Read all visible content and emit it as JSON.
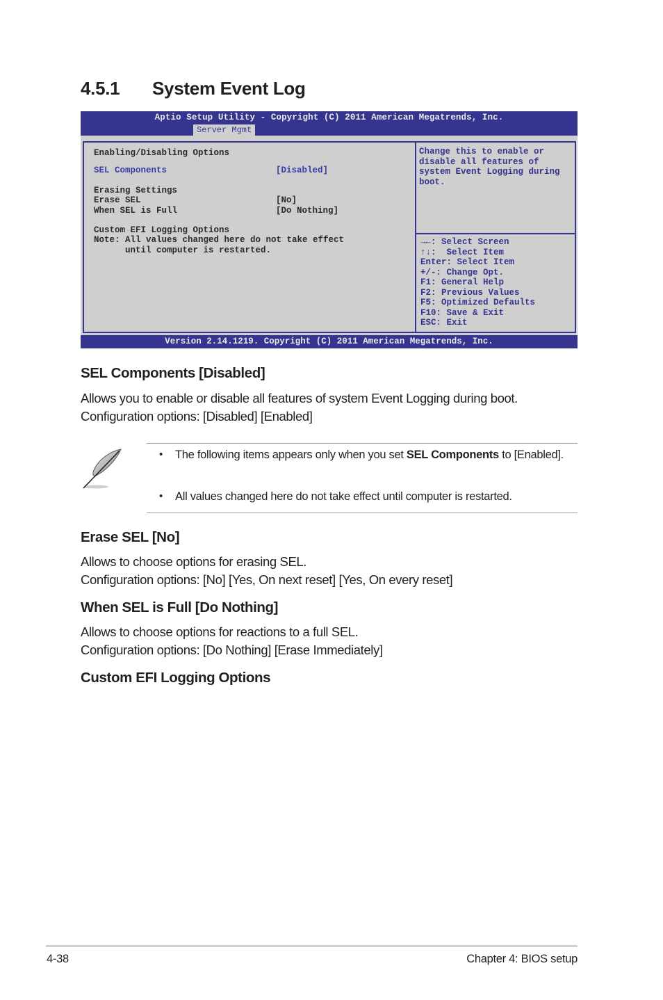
{
  "section": {
    "number": "4.5.1",
    "title": "System Event Log"
  },
  "bios": {
    "header_title": "Aptio Setup Utility - Copyright (C) 2011 American Megatrends, Inc.",
    "active_tab": "Server Mgmt",
    "footer": "Version 2.14.1219. Copyright (C) 2011 American Megatrends, Inc.",
    "main": {
      "group1_label": "Enabling/Disabling Options",
      "sel_components": {
        "label": "SEL Components",
        "value": "[Disabled]"
      },
      "group2_label": "Erasing Settings",
      "erase_sel": {
        "label": "Erase SEL",
        "value": "[No]"
      },
      "when_full": {
        "label": "When SEL is Full",
        "value": "[Do Nothing]"
      },
      "group3_label": "Custom EFI Logging Options",
      "note_line1": "Note: All values changed here do not take effect",
      "note_line2": "      until computer is restarted."
    },
    "help": [
      "Change this to enable or",
      "disable all features of",
      "system Event Logging during",
      "boot."
    ],
    "keys": [
      "→←: Select Screen",
      "↑↓:  Select Item",
      "Enter: Select Item",
      "+/-: Change Opt.",
      "F1: General Help",
      "F2: Previous Values",
      "F5: Optimized Defaults",
      "F10: Save & Exit",
      "ESC: Exit"
    ],
    "colors": {
      "bar": "#35348e",
      "panel": "#cfcfcf",
      "highlight": "#3a3aa8"
    }
  },
  "sel_components": {
    "heading": "SEL Components [Disabled]",
    "desc": "Allows you to enable or disable all features of system Event Logging during boot.",
    "options": "Configuration options: [Disabled] [Enabled]"
  },
  "note": {
    "bullet": "•",
    "item1_pre": "The following items appears only when you set ",
    "item1_bold": "SEL Components",
    "item1_post": " to [Enabled].",
    "item2": "All values changed here do not take effect until computer is restarted."
  },
  "erase_sel": {
    "heading": "Erase SEL [No]",
    "desc": "Allows to choose options for erasing SEL.",
    "options": "Configuration options: [No] [Yes, On next reset] [Yes, On every reset]"
  },
  "when_full": {
    "heading": "When SEL is Full [Do Nothing]",
    "desc": "Allows to choose options for reactions to a full SEL.",
    "options": "Configuration options: [Do Nothing] [Erase Immediately]"
  },
  "custom_efi": {
    "heading": "Custom EFI Logging Options"
  },
  "footer": {
    "page": "4-38",
    "chapter": "Chapter 4: BIOS setup"
  }
}
